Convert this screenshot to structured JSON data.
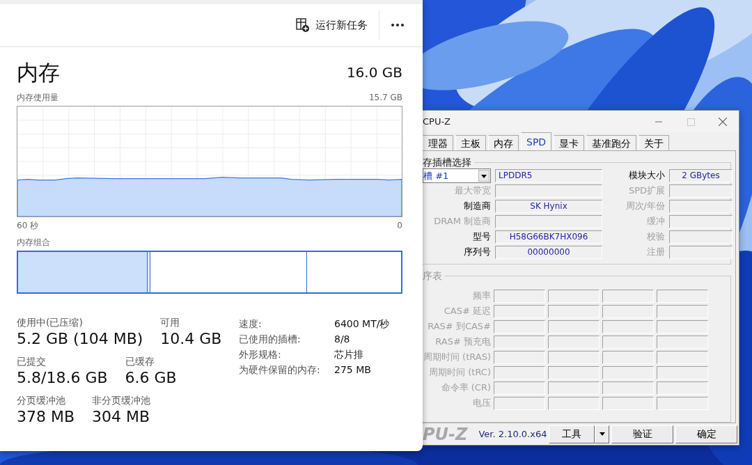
{
  "task_manager": {
    "toolbar": {
      "run_new_task": "运行新任务"
    },
    "memory": {
      "title": "内存",
      "total": "16.0 GB",
      "usage_label": "内存使用量",
      "usage_max": "15.7 GB",
      "time_start": "60 秒",
      "time_end": "0",
      "composition_label": "内存组合",
      "composition": [
        {
          "kind": "in_use",
          "level": 0.336
        },
        {
          "kind": "modified",
          "level": 0.007
        },
        {
          "kind": "standby"
        },
        {
          "kind": "free",
          "level": 0.247
        }
      ],
      "stat_rows": [
        [
          {
            "label": "使用中(已压缩)",
            "value": "5.2 GB (104 MB)"
          },
          {
            "label": "可用",
            "value": "10.4 GB"
          }
        ],
        [
          {
            "label": "已提交",
            "value": "5.8/18.6 GB"
          },
          {
            "label": "已缓存",
            "value": "6.6 GB"
          }
        ],
        [
          {
            "label": "分页缓冲池",
            "value": "378 MB"
          },
          {
            "label": "非分页缓冲池",
            "value": "304 MB"
          }
        ]
      ],
      "details": [
        {
          "label": "速度:",
          "value": "6400 MT/秒"
        },
        {
          "label": "已使用的插槽:",
          "value": "8/8"
        },
        {
          "label": "外形规格:",
          "value": "芯片排"
        },
        {
          "label": "为硬件保留的内存:",
          "value": "275 MB"
        }
      ]
    }
  },
  "cpuz": {
    "title": "CPU-Z",
    "tabs": [
      {
        "label": "理器",
        "selected": false
      },
      {
        "label": "主板",
        "selected": false
      },
      {
        "label": "内存",
        "selected": false
      },
      {
        "label": "SPD",
        "selected": true
      },
      {
        "label": "显卡",
        "selected": false
      },
      {
        "label": "基准跑分",
        "selected": false
      },
      {
        "label": "关于",
        "selected": false
      }
    ],
    "slot_group": "存插槽选择",
    "slot_rows": [
      {
        "kind": "select",
        "select": "槽 #1",
        "value": "LPDDR5",
        "right": {
          "label": "模块大小",
          "value": "2 GBytes",
          "disabled": false
        }
      },
      {
        "kind": "field",
        "label": "最大带宽",
        "disabled": true,
        "right": {
          "label": "SPD扩展",
          "disabled": true
        }
      },
      {
        "kind": "field",
        "label": "制造商",
        "value": "SK Hynix",
        "disabled": false,
        "right": {
          "label": "周次/年份",
          "disabled": true
        }
      },
      {
        "kind": "field",
        "label": "DRAM 制造商",
        "disabled": true,
        "right": {
          "label": "缓冲",
          "disabled": true
        }
      },
      {
        "kind": "field",
        "label": "型号",
        "value": "H58G66BK7HX096",
        "disabled": false,
        "right": {
          "label": "校验",
          "disabled": true
        }
      },
      {
        "kind": "field",
        "label": "序列号",
        "value": "00000000",
        "disabled": false,
        "right": {
          "label": "注册",
          "disabled": true
        }
      }
    ],
    "timing_group": "序表",
    "timings": [
      {
        "label": "频率",
        "disabled": true
      },
      {
        "label": "CAS# 延迟",
        "disabled": true
      },
      {
        "label": "RAS# 到CAS#",
        "disabled": true
      },
      {
        "label": "RAS# 预充电",
        "disabled": true
      },
      {
        "label": "周期时间 (tRAS)",
        "disabled": true
      },
      {
        "label": "周期时间 (tRC)",
        "disabled": true
      },
      {
        "label": "命令率 (CR)",
        "disabled": true
      },
      {
        "label": "电压",
        "disabled": true
      }
    ],
    "logo": "PU-Z",
    "version": "Ver. 2.10.0.x64",
    "buttons": [
      {
        "label": "工具",
        "kind": "split"
      },
      {
        "label": "验证",
        "kind": "plain"
      },
      {
        "label": "确定",
        "kind": "plain"
      }
    ]
  }
}
